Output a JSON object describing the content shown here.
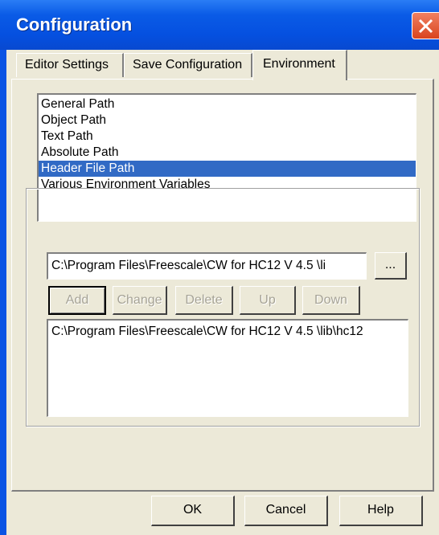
{
  "window": {
    "title": "Configuration"
  },
  "tabs": [
    {
      "label": "Editor Settings",
      "active": false
    },
    {
      "label": "Save Configuration",
      "active": false
    },
    {
      "label": "Environment",
      "active": true
    }
  ],
  "env_list": {
    "items": [
      "General Path",
      "Object Path",
      "Text Path",
      "Absolute Path",
      "Header File Path",
      "Various Environment Variables"
    ],
    "selected_index": 4
  },
  "path_field": {
    "value": "C:\\Program Files\\Freescale\\CW for HC12 V 4.5  \\li"
  },
  "browse_button": {
    "label": "..."
  },
  "action_buttons": {
    "add": "Add",
    "change": "Change",
    "delete": "Delete",
    "up": "Up",
    "down": "Down"
  },
  "path_list": {
    "items": [
      "C:\\Program Files\\Freescale\\CW for HC12 V 4.5  \\lib\\hc12"
    ]
  },
  "dialog_buttons": {
    "ok": "OK",
    "cancel": "Cancel",
    "help": "Help"
  },
  "colors": {
    "title_bar": "#0a54e4",
    "dialog_face": "#ece9d8",
    "selection": "#316ac5",
    "close_button": "#e05a36"
  }
}
